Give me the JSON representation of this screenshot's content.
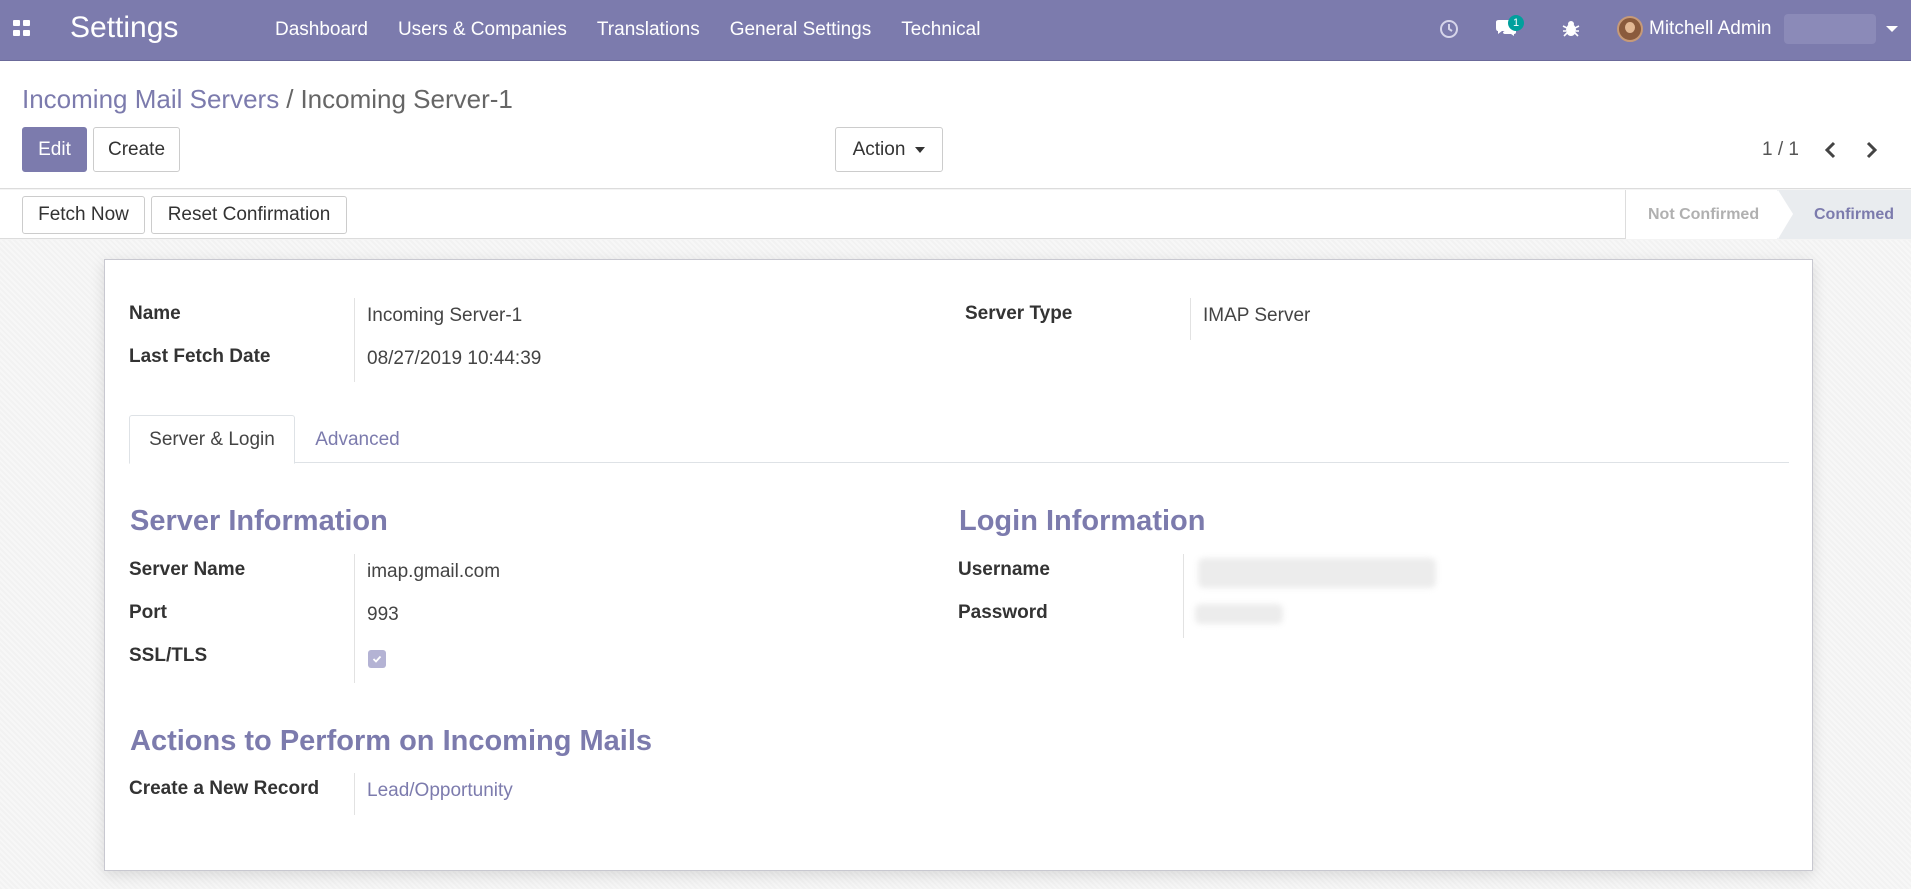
{
  "navbar": {
    "app_title": "Settings",
    "menu": [
      "Dashboard",
      "Users & Companies",
      "Translations",
      "General Settings",
      "Technical"
    ],
    "chat_badge": "1",
    "user_name": "Mitchell Admin",
    "icons": [
      "apps-icon",
      "clock-icon",
      "chat-icon",
      "bug-icon",
      "avatar",
      "caret-down-icon"
    ]
  },
  "breadcrumb": {
    "parent": "Incoming Mail Servers",
    "separator": "/",
    "current": "Incoming Server-1"
  },
  "control": {
    "edit_label": "Edit",
    "create_label": "Create",
    "action_label": "Action",
    "pager": "1 / 1"
  },
  "statusbar": {
    "fetch_label": "Fetch Now",
    "reset_label": "Reset Confirmation",
    "stages": [
      "Not Confirmed",
      "Confirmed"
    ],
    "active_stage": "Confirmed"
  },
  "form": {
    "name_label": "Name",
    "name_value": "Incoming Server-1",
    "last_fetch_label": "Last Fetch Date",
    "last_fetch_value": "08/27/2019 10:44:39",
    "server_type_label": "Server Type",
    "server_type_value": "IMAP Server",
    "tabs": [
      "Server & Login",
      "Advanced"
    ],
    "server_info_title": "Server Information",
    "server_name_label": "Server Name",
    "server_name_value": "imap.gmail.com",
    "port_label": "Port",
    "port_value": "993",
    "ssl_label": "SSL/TLS",
    "ssl_checked": true,
    "login_info_title": "Login Information",
    "username_label": "Username",
    "password_label": "Password",
    "actions_title": "Actions to Perform on Incoming Mails",
    "create_record_label": "Create a New Record",
    "create_record_value": "Lead/Opportunity"
  },
  "colors": {
    "brand": "#7c7bad",
    "badge": "#00a09d"
  }
}
